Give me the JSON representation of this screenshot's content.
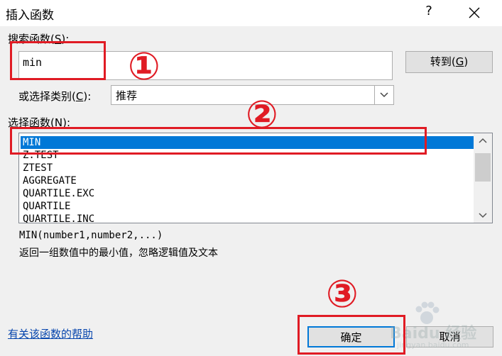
{
  "window": {
    "title": "插入函数",
    "help_symbol": "?",
    "close_symbol": "X"
  },
  "search": {
    "label_prefix": "搜索函数(",
    "label_key": "S",
    "label_suffix": "):",
    "value": "min",
    "goto_prefix": "转到(",
    "goto_key": "G",
    "goto_suffix": ")"
  },
  "category": {
    "label_prefix": "或选择类别(",
    "label_key": "C",
    "label_suffix": "):",
    "selected": "推荐"
  },
  "functions": {
    "label_prefix": "选择函数(",
    "label_key": "N",
    "label_suffix": "):",
    "items": [
      "MIN",
      "Z.TEST",
      "ZTEST",
      "AGGREGATE",
      "QUARTILE.EXC",
      "QUARTILE",
      "QUARTILE.INC"
    ],
    "selected_index": 0
  },
  "description": {
    "signature": "MIN(number1,number2,...)",
    "text": "返回一组数值中的最小值，忽略逻辑值及文本"
  },
  "footer": {
    "help_link": "有关该函数的帮助",
    "ok": "确定",
    "cancel": "取消"
  },
  "annotations": {
    "color": "#e01b24",
    "labels": [
      "①",
      "②",
      "③"
    ]
  },
  "watermark": {
    "text": "Baidu 经验",
    "subtext": "jingyan.baidu.com"
  }
}
